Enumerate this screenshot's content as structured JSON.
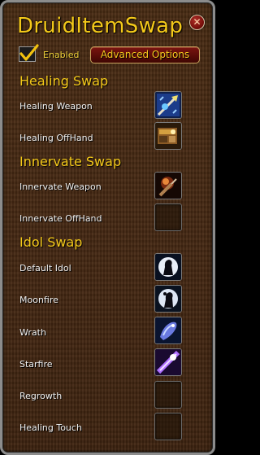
{
  "window": {
    "title": "DruidItemSwap",
    "close_icon": "close-icon"
  },
  "toolbar": {
    "enabled_label": "Enabled",
    "enabled_checked": true,
    "advanced_button_label": "Advanced Options"
  },
  "sections": [
    {
      "header": "Healing Swap",
      "rows": [
        {
          "label": "Healing Weapon",
          "icon": "healing-weapon-icon",
          "filled": true
        },
        {
          "label": "Healing OffHand",
          "icon": "healing-offhand-icon",
          "filled": true
        }
      ]
    },
    {
      "header": "Innervate Swap",
      "rows": [
        {
          "label": "Innervate Weapon",
          "icon": "innervate-weapon-icon",
          "filled": true
        },
        {
          "label": "Innervate OffHand",
          "icon": "",
          "filled": false
        }
      ]
    },
    {
      "header": "Idol Swap",
      "rows": [
        {
          "label": "Default Idol",
          "icon": "default-idol-icon",
          "filled": true
        },
        {
          "label": "Moonfire",
          "icon": "moonfire-idol-icon",
          "filled": true
        },
        {
          "label": "Wrath",
          "icon": "wrath-idol-icon",
          "filled": true
        },
        {
          "label": "Starfire",
          "icon": "starfire-idol-icon",
          "filled": true
        },
        {
          "label": "Regrowth",
          "icon": "",
          "filled": false
        },
        {
          "label": "Healing Touch",
          "icon": "",
          "filled": false
        }
      ]
    }
  ],
  "colors": {
    "title": "#f4c91a",
    "label": "#f0f0f0",
    "background": "#462913"
  }
}
